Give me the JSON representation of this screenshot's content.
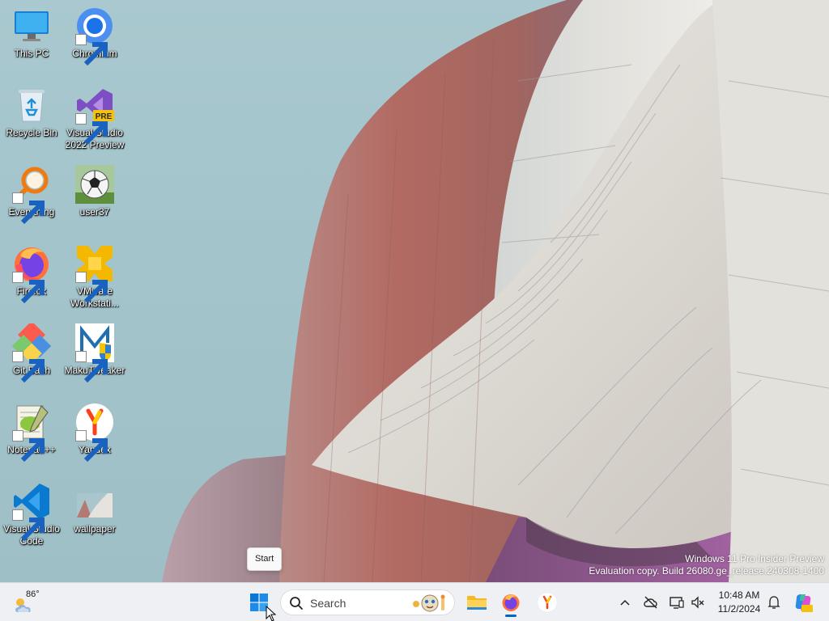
{
  "desktop": {
    "icons": [
      {
        "label": "This PC"
      },
      {
        "label": "Chromium"
      },
      {
        "label": "Recycle Bin"
      },
      {
        "label": "Visual Studio 2022 Preview",
        "badge": "PRE"
      },
      {
        "label": "Everything"
      },
      {
        "label": "user37"
      },
      {
        "label": "Firefox"
      },
      {
        "label": "VMware Workstati..."
      },
      {
        "label": "Git Bash"
      },
      {
        "label": "MakuTweaker"
      },
      {
        "label": "Notepad++"
      },
      {
        "label": "Yandex"
      },
      {
        "label": "Visual Studio Code"
      },
      {
        "label": "wallpaper"
      }
    ]
  },
  "watermark": {
    "line1": "Windows 11 Pro Insider Preview",
    "line2": "Evaluation copy. Build 26080.ge_release.240308-1400"
  },
  "tooltip": {
    "text": "Start"
  },
  "taskbar": {
    "weather": {
      "temp": "86°"
    },
    "search": {
      "placeholder": "Search"
    },
    "clock": {
      "time": "10:48 AM",
      "date": "11/2/2024"
    },
    "accent": "#0067c0"
  },
  "icons": {
    "start": "windows-logo-icon",
    "search": "search-icon",
    "explorer": "folder-icon",
    "tray": [
      "chevron-up-icon",
      "network-disconnected-icon",
      "display-icon",
      "volume-muted-icon",
      "notification-bell-icon",
      "copilot-icon"
    ]
  }
}
